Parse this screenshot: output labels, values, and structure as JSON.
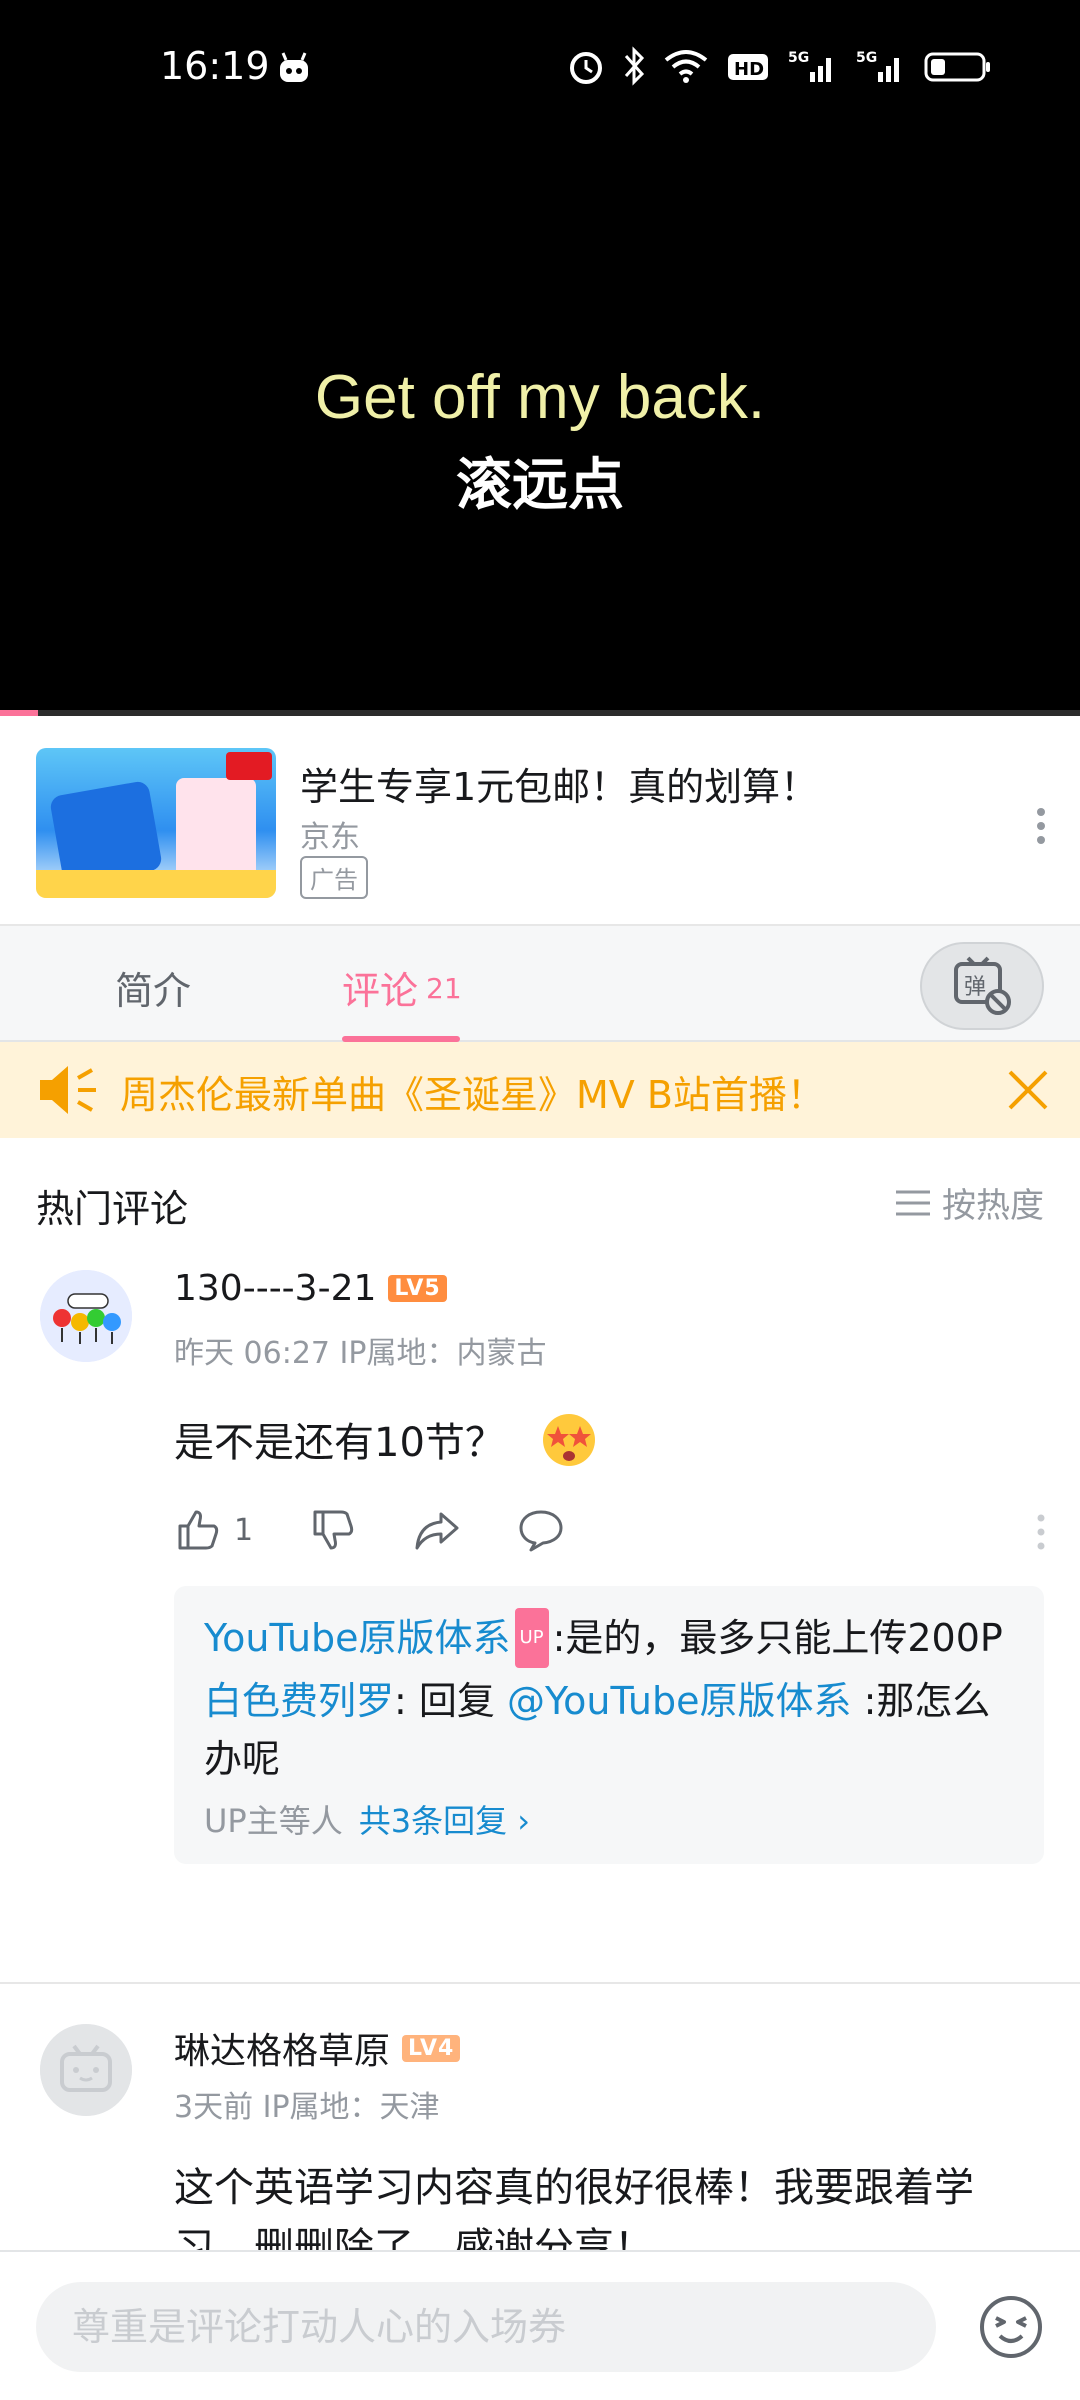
{
  "status_bar": {
    "time": "16:19",
    "icons": [
      "alarm-icon",
      "bluetooth-icon",
      "wifi-icon",
      "hd-icon",
      "signal-5g-icon",
      "signal-5g-icon",
      "battery-icon"
    ]
  },
  "video": {
    "subtitle_en": "Get off my back.",
    "subtitle_zh": "滚远点",
    "progress_percent": 3.5
  },
  "ad": {
    "title": "学生专享1元包邮！真的划算！",
    "brand": "京东",
    "tag": "广告"
  },
  "tabs": {
    "intro": "简介",
    "comments": "评论",
    "comments_count": "21",
    "danmaku_glyph": "弹"
  },
  "notice": {
    "text": "周杰伦最新单曲《圣诞星》MV B站首播！"
  },
  "comments_header": {
    "title": "热门评论",
    "sort_label": "按热度"
  },
  "comments": [
    {
      "username": "130----3-21",
      "level": "LV5",
      "meta": "昨天 06:27  IP属地：内蒙古",
      "text": "是不是还有10节？",
      "likes": "1",
      "replies": [
        {
          "user": "YouTube原版体系",
          "up": "UP",
          "text": ":是的，最多只能上传200P"
        },
        {
          "user": "白色费列罗",
          "text_before": ": 回复 ",
          "mention": "@YouTube原版体系",
          "text_after": " :那怎么办呢"
        }
      ],
      "reply_footer_prefix": "UP主等人",
      "reply_footer_count": "共3条回复 ›"
    },
    {
      "username": "琳达格格草原",
      "level": "LV4",
      "meta": "3天前  IP属地：天津",
      "text": "这个英语学习内容真的很好很棒！我要跟着学习，删删除了，感谢分享！"
    }
  ],
  "bottom_bar": {
    "placeholder": "尊重是评论打动人心的入场券"
  },
  "colors": {
    "accent_pink": "#fb7299",
    "link_blue": "#178bcf",
    "notice_orange": "#f5a000"
  }
}
